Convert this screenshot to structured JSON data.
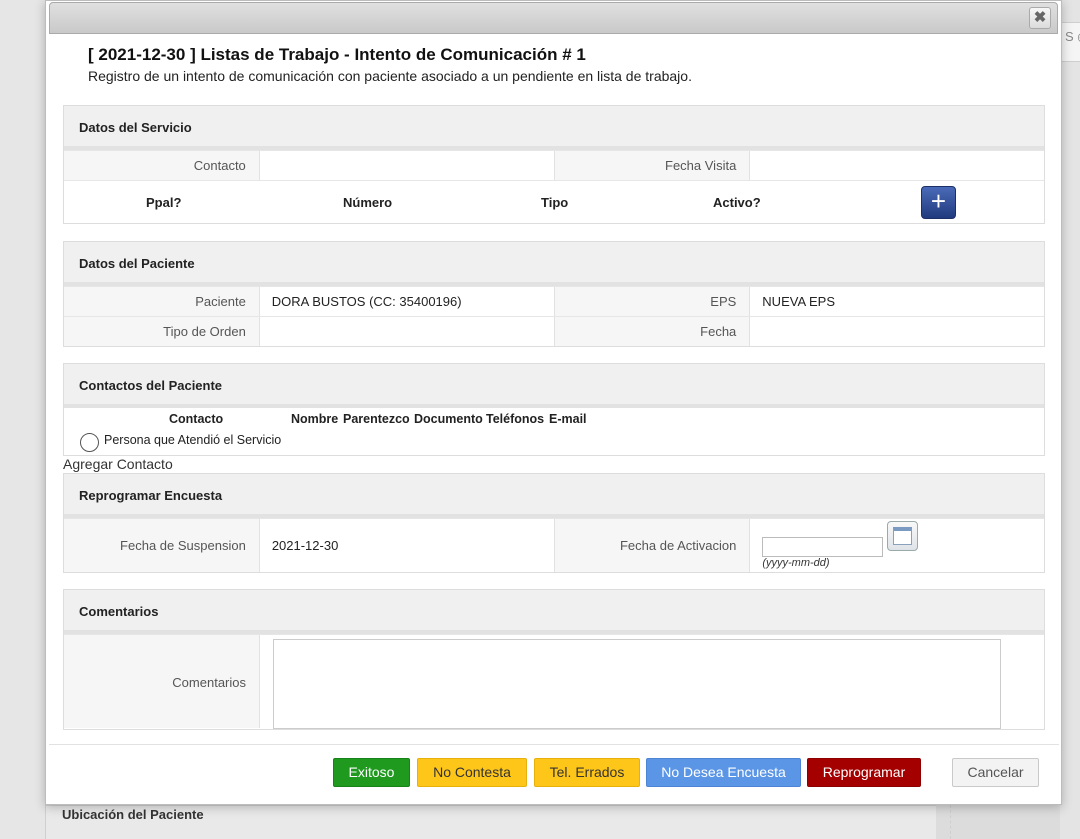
{
  "background": {
    "right_tab_text": "S ◉",
    "bottom_section_label": "Ubicación del Paciente"
  },
  "dialog": {
    "title": "[ 2021-12-30 ] Listas de Trabajo - Intento de Comunicación # 1",
    "subtitle": "Registro de un intento de comunicación con paciente asociado a un pendiente en lista de trabajo.",
    "close_icon": "✖"
  },
  "servicio": {
    "header": "Datos del Servicio",
    "contacto_label": "Contacto",
    "contacto_value": "",
    "fecha_visita_label": "Fecha Visita",
    "fecha_visita_value": "",
    "phone_columns": [
      "Ppal?",
      "Número",
      "Tipo",
      "Activo?"
    ],
    "add_phone_icon": "+"
  },
  "paciente": {
    "header": "Datos del Paciente",
    "paciente_label": "Paciente",
    "paciente_value": "DORA BUSTOS (CC: 35400196)",
    "eps_label": "EPS",
    "eps_value": "NUEVA EPS",
    "tipo_orden_label": "Tipo de Orden",
    "tipo_orden_value": "",
    "fecha_label": "Fecha",
    "fecha_value": ""
  },
  "contactos": {
    "header": "Contactos del Paciente",
    "columns": [
      "Contacto",
      "Nombre",
      "Parentezco",
      "Documento",
      "Teléfonos",
      "E-mail"
    ],
    "radio_label": "Persona que Atendió el Servicio",
    "add_contact": "Agregar Contacto"
  },
  "reprogramar": {
    "header": "Reprogramar Encuesta",
    "suspension_label": "Fecha de Suspension",
    "suspension_value": "2021-12-30",
    "activacion_label": "Fecha de Activacion",
    "activacion_value": "",
    "date_hint": "(yyyy-mm-dd)"
  },
  "comentarios": {
    "header": "Comentarios",
    "label": "Comentarios",
    "value": ""
  },
  "buttons": {
    "exitoso": "Exitoso",
    "no_contesta": "No Contesta",
    "tel_errados": "Tel. Errados",
    "no_desea": "No Desea Encuesta",
    "reprogramar": "Reprogramar",
    "cancelar": "Cancelar"
  },
  "colors": {
    "exitoso": "#1f9a1f",
    "no_contesta": "#ffc61a",
    "tel_errados": "#ffc61a",
    "no_desea": "#5b95e6",
    "reprogramar": "#a40000",
    "add_phone": "#2c4a9a"
  }
}
